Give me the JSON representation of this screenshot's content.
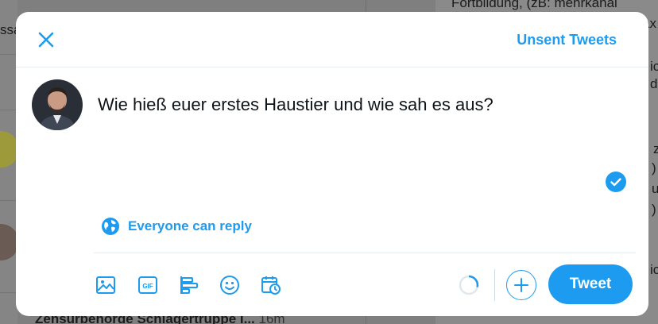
{
  "background": {
    "top_right_text": "Fortbildung, (zB: mehrkanal",
    "top_right_suffix": "ax",
    "top_left_text": "ssa",
    "bottom_text": "Zensurbehörde Schlagertruppe I...",
    "bottom_time": "16m",
    "right_fragments": [
      "ic",
      "d",
      "z",
      ")",
      "u",
      ")",
      "ic"
    ]
  },
  "header": {
    "unsent_label": "Unsent Tweets"
  },
  "compose": {
    "text": "Wie hieß euer erstes Haustier und wie sah es aus?"
  },
  "reply_setting": {
    "label": "Everyone can reply"
  },
  "actions": {
    "tweet_label": "Tweet"
  },
  "icons": {
    "close": "close-icon",
    "globe": "globe-icon",
    "media": "image-icon",
    "gif": "gif-icon",
    "poll": "poll-icon",
    "emoji": "emoji-icon",
    "schedule": "schedule-icon",
    "add": "plus-icon",
    "check": "check-circle-icon"
  },
  "colors": {
    "accent": "#1d9bf0",
    "text": "#0f1419",
    "overlay": "#7f7f80"
  }
}
